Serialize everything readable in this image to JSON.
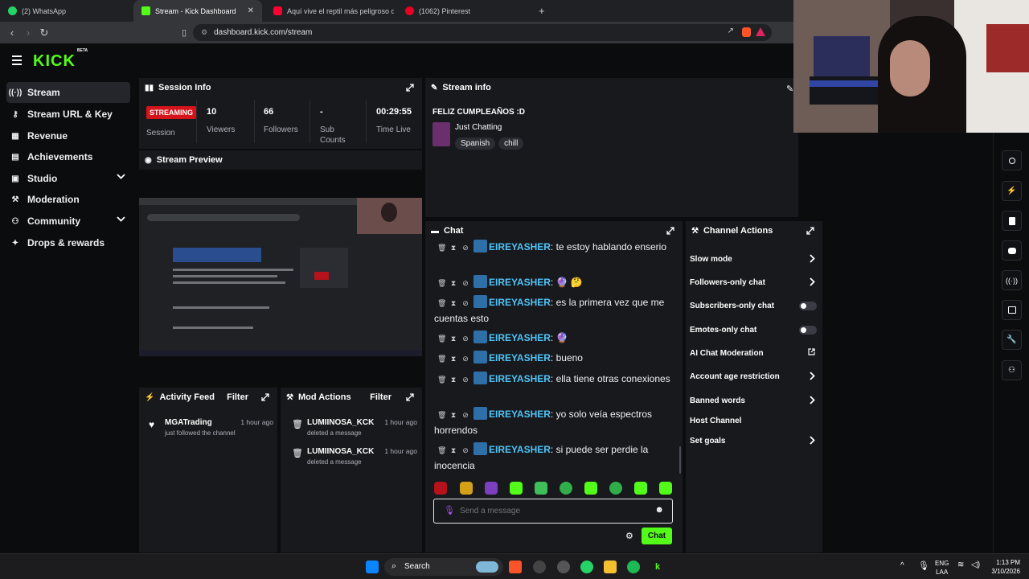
{
  "browser": {
    "tabs": [
      {
        "title": "(2) WhatsApp",
        "color": "#25d366"
      },
      {
        "title": "Stream - Kick Dashboard",
        "color": "#53fc18"
      },
      {
        "title": "Aquí vive el reptil más peligroso del",
        "color": "#ff0033"
      },
      {
        "title": "(1062) Pinterest",
        "color": "#e60023"
      }
    ],
    "url": "dashboard.kick.com/stream"
  },
  "app": {
    "logo": "KICK",
    "logo_badge": "BETA"
  },
  "sidebar": {
    "items": [
      {
        "label": "Stream",
        "icon": "stream-icon"
      },
      {
        "label": "Stream URL & Key",
        "icon": "key-icon"
      },
      {
        "label": "Revenue",
        "icon": "revenue-icon"
      },
      {
        "label": "Achievements",
        "icon": "achievements-icon"
      },
      {
        "label": "Studio",
        "icon": "studio-icon"
      },
      {
        "label": "Moderation",
        "icon": "moderation-icon"
      },
      {
        "label": "Community",
        "icon": "community-icon"
      },
      {
        "label": "Drops & rewards",
        "icon": "drops-icon"
      }
    ]
  },
  "session": {
    "title": "Session Info",
    "status": "STREAMING",
    "status_label": "Session",
    "viewers": "10",
    "viewers_label": "Viewers",
    "followers": "66",
    "followers_label": "Followers",
    "subs": "-",
    "subs_label1": "Sub",
    "subs_label2": "Counts",
    "time": "00:29:55",
    "time_label": "Time Live"
  },
  "preview": {
    "title": "Stream Preview"
  },
  "stream_info": {
    "title": "Stream info",
    "stream_title": "FELIZ CUMPLEAÑOS :D",
    "category": "Just Chatting",
    "tags": [
      "Spanish",
      "chill"
    ]
  },
  "activity": {
    "title": "Activity Feed",
    "filter": "Filter",
    "items": [
      {
        "user": "MGATrading",
        "action": "just followed the channel",
        "time": "1 hour ago"
      }
    ]
  },
  "mod_actions": {
    "title": "Mod Actions",
    "filter": "Filter",
    "items": [
      {
        "user": "LUMIINOSA_KCK",
        "action": "deleted a message",
        "time": "1 hour ago"
      },
      {
        "user": "LUMIINOSA_KCK",
        "action": "deleted a message",
        "time": "1 hour ago"
      }
    ]
  },
  "chat": {
    "title": "Chat",
    "messages": [
      {
        "user": "EIREYASHER",
        "text": ": te estoy hablando enserio"
      },
      {
        "user": "EIREYASHER",
        "text": ": 🔮 🤔"
      },
      {
        "user": "EIREYASHER",
        "text": ": es la primera vez que me cuentas esto"
      },
      {
        "user": "EIREYASHER",
        "text": ": 🔮"
      },
      {
        "user": "EIREYASHER",
        "text": ": bueno"
      },
      {
        "user": "EIREYASHER",
        "text": ": ella tiene otras conexiones"
      },
      {
        "user": "EIREYASHER",
        "text": ": yo solo veía espectros horrendos"
      },
      {
        "user": "EIREYASHER",
        "text": ": si puede ser perdie la inocencia"
      }
    ],
    "input_placeholder": "Send a message",
    "send_label": "Chat"
  },
  "channel_actions": {
    "title": "Channel Actions",
    "items": [
      {
        "label": "Slow mode",
        "control": "arrow"
      },
      {
        "label": "Followers-only chat",
        "control": "arrow"
      },
      {
        "label": "Subscribers-only chat",
        "control": "toggle-off"
      },
      {
        "label": "Emotes-only chat",
        "control": "toggle-off"
      },
      {
        "label": "AI Chat Moderation",
        "control": "external"
      },
      {
        "label": "Account age restriction",
        "control": "arrow"
      },
      {
        "label": "Banned words",
        "control": "arrow"
      },
      {
        "label": "Host Channel",
        "control": "none"
      },
      {
        "label": "Set goals",
        "control": "arrow"
      }
    ]
  },
  "taskbar": {
    "search": "Search",
    "lang1": "ENG",
    "lang2": "LAA",
    "time": "1:13 PM",
    "date": "3/10/2026"
  },
  "colors": {
    "accent": "#53fc18",
    "live": "#d4141a",
    "username": "#4fc3f7"
  }
}
